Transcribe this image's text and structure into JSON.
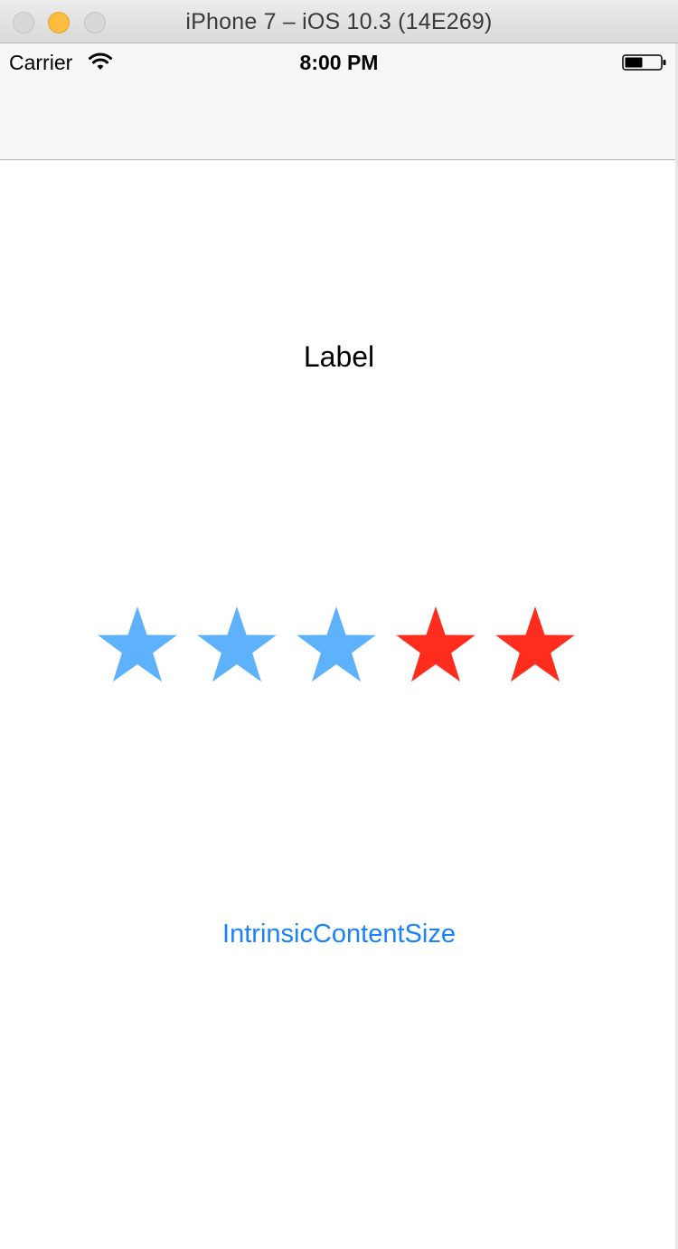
{
  "window": {
    "title": "iPhone 7 – iOS 10.3 (14E269)"
  },
  "status_bar": {
    "carrier": "Carrier",
    "time": "8:00 PM",
    "wifi_icon": "wifi-icon",
    "battery_icon": "battery-icon"
  },
  "content": {
    "label": "Label",
    "rating": {
      "value": 3,
      "max": 5,
      "filled_color": "#5eb2fb",
      "empty_color": "#ff2d1d"
    },
    "button_label": "IntrinsicContentSize"
  }
}
